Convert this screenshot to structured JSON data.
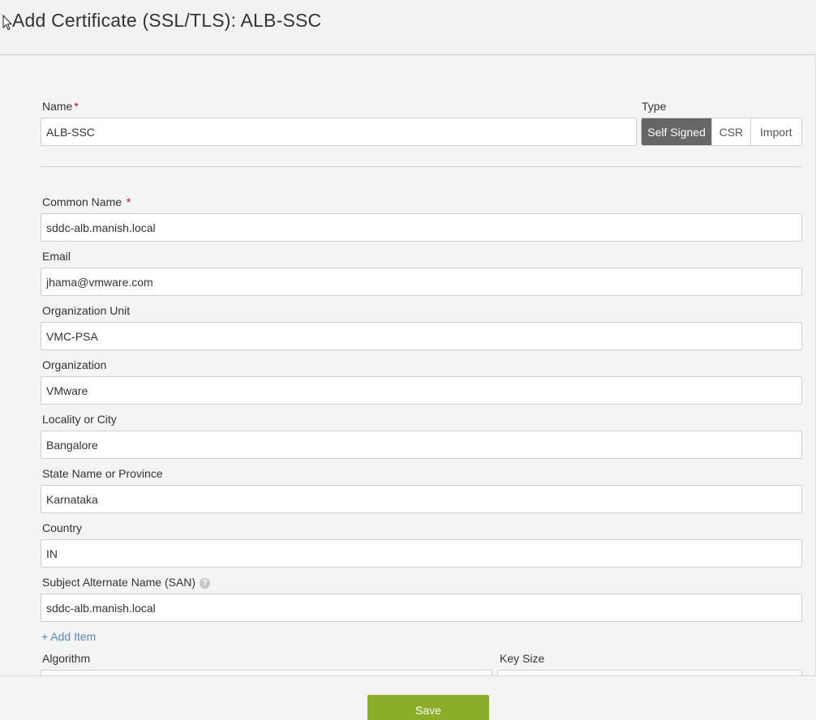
{
  "header": {
    "title": "Add Certificate (SSL/TLS): ALB-SSC"
  },
  "form": {
    "name": {
      "label": "Name",
      "required": "*",
      "value": "ALB-SSC"
    },
    "type": {
      "label": "Type",
      "options": [
        "Self Signed",
        "CSR",
        "Import"
      ],
      "selected": "Self Signed"
    },
    "common_name": {
      "label": "Common Name",
      "required": "*",
      "value": "sddc-alb.manish.local"
    },
    "email": {
      "label": "Email",
      "value": "jhama@vmware.com"
    },
    "org_unit": {
      "label": "Organization Unit",
      "value": "VMC-PSA"
    },
    "organization": {
      "label": "Organization",
      "value": "VMware"
    },
    "locality": {
      "label": "Locality or City",
      "value": "Bangalore"
    },
    "state": {
      "label": "State Name or Province",
      "value": "Karnataka"
    },
    "country": {
      "label": "Country",
      "value": "IN"
    },
    "san": {
      "label": "Subject Alternate Name (SAN)",
      "help_icon": "?",
      "value": "sddc-alb.manish.local"
    },
    "add_item": "+ Add Item",
    "algorithm": {
      "label": "Algorithm"
    },
    "key_size": {
      "label": "Key Size"
    }
  },
  "footer": {
    "save_label": "Save"
  },
  "colors": {
    "accent_save": "#8aae2a",
    "selected_segment": "#666666",
    "required": "#d0021b",
    "link": "#5b86b6"
  },
  "icons": [
    "cursor-arrow-icon",
    "help-icon"
  ]
}
